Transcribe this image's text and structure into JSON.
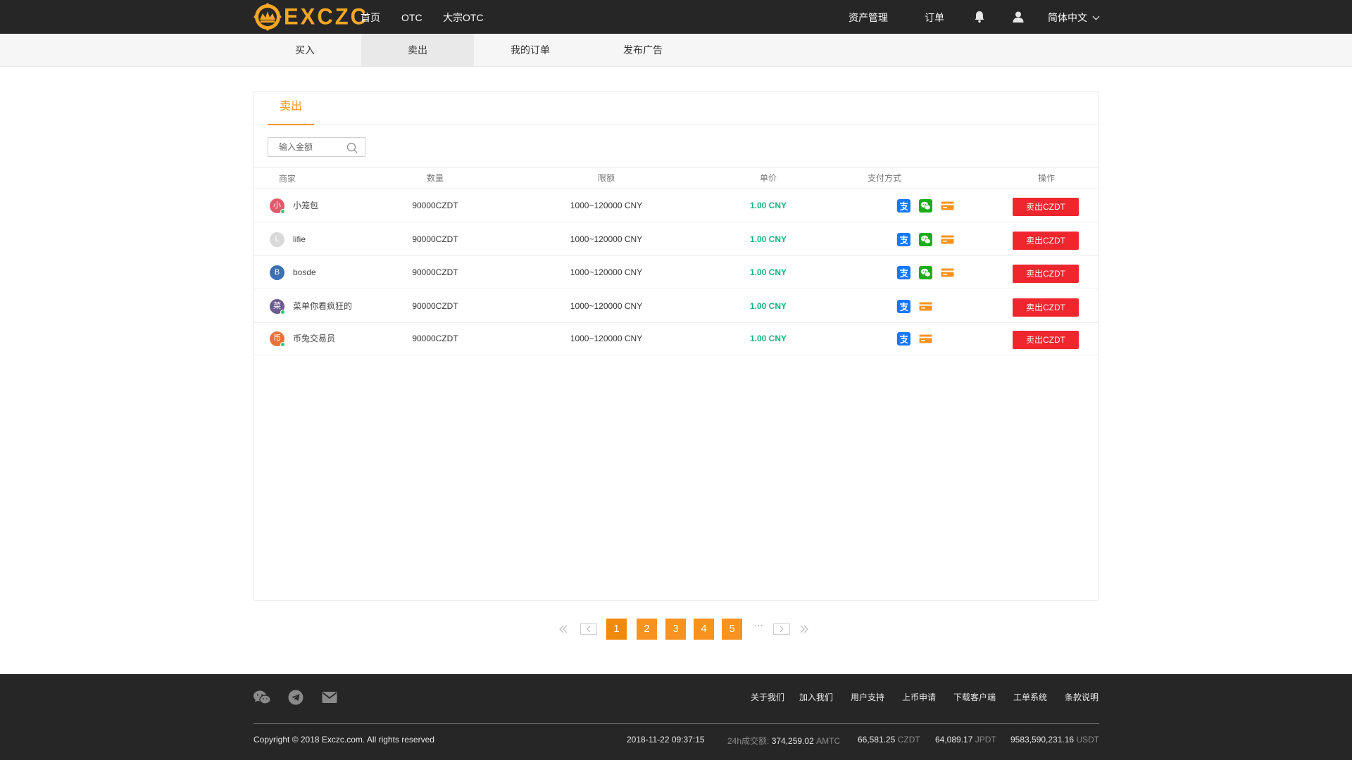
{
  "header": {
    "brand": "EXCZC",
    "nav": [
      "首页",
      "OTC",
      "大宗OTC"
    ],
    "asset_mgmt": "资产管理",
    "orders": "订单",
    "language": "简体中文",
    "icons": {
      "bell": "bell-icon",
      "user": "user-icon",
      "chevron": "chevron-down-icon"
    }
  },
  "subnav": {
    "tabs": [
      "买入",
      "卖出",
      "我的订单",
      "发布广告"
    ],
    "active_index": 1
  },
  "panel": {
    "tab_label": "卖出",
    "search_placeholder": "输入金额",
    "columns": [
      "商家",
      "数量",
      "限额",
      "单价",
      "支付方式",
      "操作"
    ],
    "rows": [
      {
        "avatar_char": "小",
        "avatar_color": "#e05a6b",
        "online": true,
        "merchant": "小笼包",
        "amount": "90000CZDT",
        "limit": "1000~120000 CNY",
        "price": "1.00 CNY",
        "payments": [
          "alipay",
          "wechat",
          "bankcard"
        ],
        "action": "卖出CZDT"
      },
      {
        "avatar_char": "L",
        "avatar_color": "#d9d9d9",
        "online": false,
        "merchant": "lifie",
        "amount": "90000CZDT",
        "limit": "1000~120000 CNY",
        "price": "1.00 CNY",
        "payments": [
          "alipay",
          "wechat",
          "bankcard"
        ],
        "action": "卖出CZDT"
      },
      {
        "avatar_char": "B",
        "avatar_color": "#3d6fb5",
        "online": false,
        "merchant": "bosde",
        "amount": "90000CZDT",
        "limit": "1000~120000 CNY",
        "price": "1.00 CNY",
        "payments": [
          "alipay",
          "wechat",
          "bankcard"
        ],
        "action": "卖出CZDT"
      },
      {
        "avatar_char": "菜",
        "avatar_color": "#6c5b8e",
        "online": true,
        "merchant": "菜单你看疯狂的",
        "amount": "90000CZDT",
        "limit": "1000~120000 CNY",
        "price": "1.00 CNY",
        "payments": [
          "alipay",
          "bankcard"
        ],
        "action": "卖出CZDT"
      },
      {
        "avatar_char": "币",
        "avatar_color": "#e8733a",
        "online": true,
        "merchant": "币兔交易员",
        "amount": "90000CZDT",
        "limit": "1000~120000 CNY",
        "price": "1.00 CNY",
        "payments": [
          "alipay",
          "bankcard"
        ],
        "action": "卖出CZDT"
      }
    ],
    "colors": {
      "accent": "#f7931e",
      "price": "#14b37d",
      "button": "#f0262e"
    }
  },
  "pagination": {
    "pages": [
      "1",
      "2",
      "3",
      "4",
      "5"
    ],
    "current": "1",
    "ellipsis": "···"
  },
  "footer": {
    "social_icons": [
      "wechat-icon",
      "telegram-icon",
      "mail-icon"
    ],
    "links": [
      "关于我们",
      "加入我们",
      "用户支持",
      "上币申请",
      "下载客户端",
      "工单系统",
      "条款说明"
    ],
    "copyright": "Copyright © 2018 Exczc.com. All rights reserved",
    "datetime": "2018-11-22  09:37:15",
    "volume_label": "24h成交额:",
    "stats": [
      {
        "value": "374,259.02",
        "unit": "AMTC"
      },
      {
        "value": "66,581.25",
        "unit": "CZDT"
      },
      {
        "value": "64,089.17",
        "unit": "JPDT"
      },
      {
        "value": "9583,590,231.16",
        "unit": "USDT"
      }
    ]
  }
}
